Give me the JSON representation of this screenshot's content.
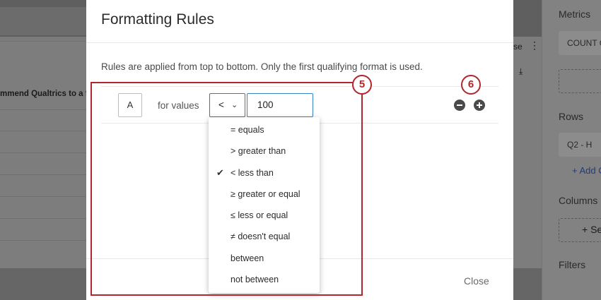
{
  "background": {
    "row_text": "mmend Qualtrics to a fr",
    "header_fragment": "se",
    "sidebar": {
      "metrics_label": "Metrics",
      "metric_chip": "COUNT Co",
      "rows_label": "Rows",
      "row_chip": "Q2 - H",
      "add_link": "+ Add C",
      "columns_label": "Columns",
      "columns_add": "+ Se",
      "filters_label": "Filters"
    }
  },
  "modal": {
    "title": "Formatting Rules",
    "description": "Rules are applied from top to bottom. Only the first qualifying format is used.",
    "rule": {
      "format_label": "A",
      "for_values_label": "for values",
      "operator_selected": "<",
      "value": "100"
    },
    "operator_options": [
      {
        "label": "= equals",
        "checked": false
      },
      {
        "label": "> greater than",
        "checked": false
      },
      {
        "label": "< less than",
        "checked": true
      },
      {
        "label": "≥ greater or equal",
        "checked": false
      },
      {
        "label": "≤ less or equal",
        "checked": false
      },
      {
        "label": "≠ doesn't equal",
        "checked": false
      },
      {
        "label": "between",
        "checked": false
      },
      {
        "label": "not between",
        "checked": false
      }
    ],
    "close_label": "Close"
  },
  "annotations": {
    "badge_5": "5",
    "badge_6": "6",
    "accent_color": "#b0272e"
  },
  "icons": {
    "operator_chevron": "chevron-down-icon",
    "remove_rule": "minus-circle-icon",
    "add_rule": "plus-circle-icon",
    "selected_check": "check-icon"
  }
}
